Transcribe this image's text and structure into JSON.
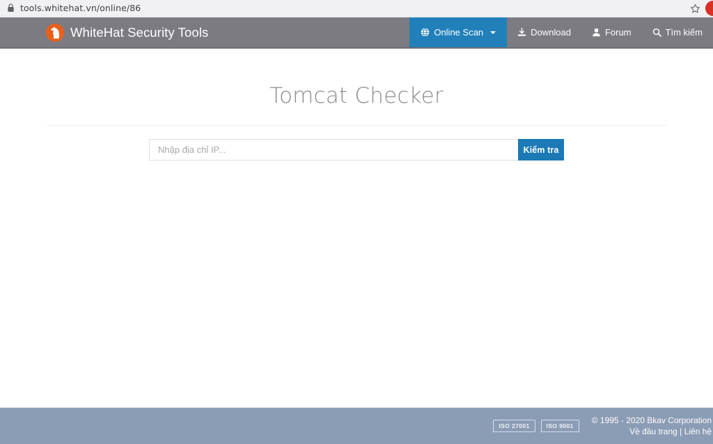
{
  "browser": {
    "lock_icon": "lock-icon",
    "url": "tools.whitehat.vn/online/86",
    "star_icon": "star-icon",
    "profile_icon": "profile-avatar"
  },
  "navbar": {
    "logo_icon": "whitehat-logo-icon",
    "brand": "WhiteHat Security Tools",
    "items": [
      {
        "label": "Online Scan",
        "icon": "globe-icon",
        "active": true,
        "has_caret": true
      },
      {
        "label": "Download",
        "icon": "download-icon",
        "active": false,
        "has_caret": false
      },
      {
        "label": "Forum",
        "icon": "user-icon",
        "active": false,
        "has_caret": false
      },
      {
        "label": "Tìm kiếm",
        "icon": "search-icon",
        "active": false,
        "has_caret": false
      }
    ]
  },
  "main": {
    "title": "Tomcat Checker",
    "input_placeholder": "Nhập địa chỉ IP...",
    "input_value": "",
    "submit_label": "Kiểm tra"
  },
  "footer": {
    "badges": [
      "ISO 27001",
      "ISO 9001"
    ],
    "copyright": "© 1995 - 2020 Bkav Corporation",
    "link_top": "Về đầu trang",
    "separator": " | ",
    "link_contact": "Liên hệ"
  },
  "colors": {
    "navbar_bg": "#7b7b81",
    "accent_blue": "#2180b9",
    "button_blue": "#1b7ab5",
    "logo_orange": "#e8601c",
    "footer_bg": "#8b9cb5",
    "title_gray": "#8c8c8c"
  }
}
